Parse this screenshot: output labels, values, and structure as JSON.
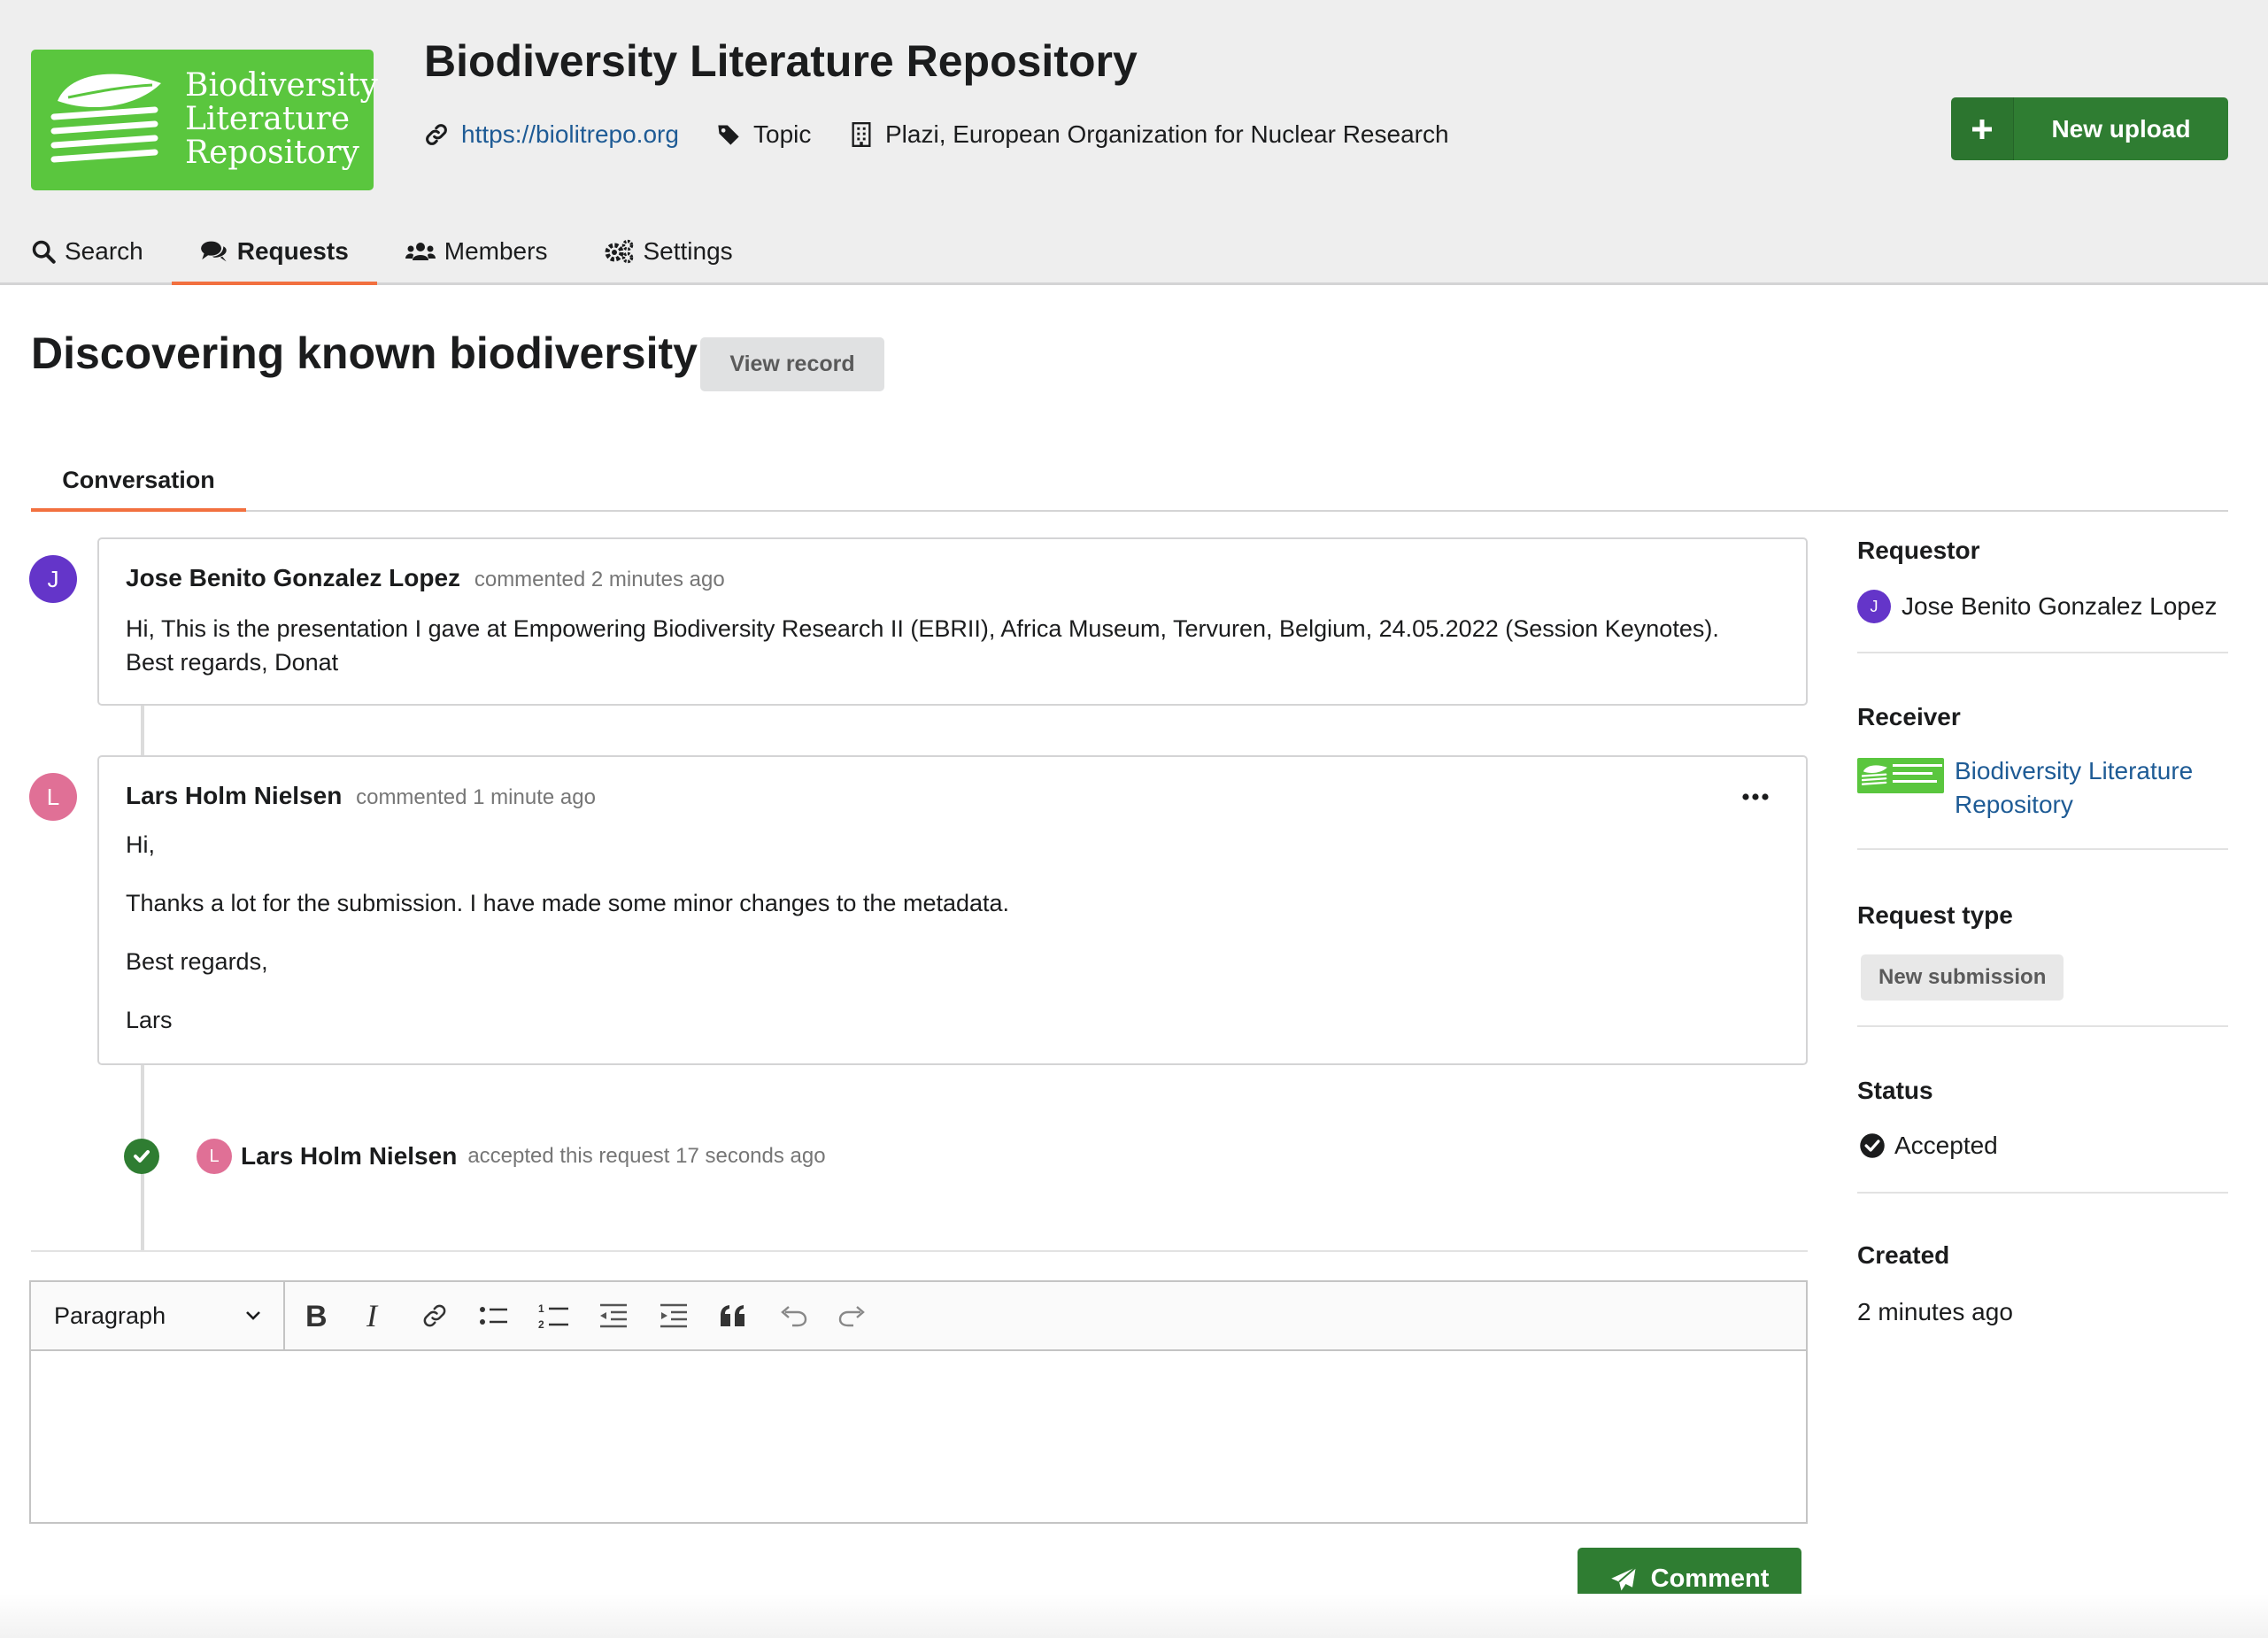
{
  "community": {
    "logo_lines": [
      "Biodiversity",
      "Literature",
      "Repository"
    ],
    "title": "Biodiversity Literature Repository",
    "website": "https://biolitrepo.org",
    "topic": "Topic",
    "organizations": "Plazi, European Organization for Nuclear Research",
    "new_upload_label": "New upload",
    "brand_color": "#5ac63e"
  },
  "menu": {
    "items": [
      {
        "label": "Search",
        "icon": "search-icon"
      },
      {
        "label": "Requests",
        "icon": "comments-icon",
        "active": true
      },
      {
        "label": "Members",
        "icon": "users-icon"
      },
      {
        "label": "Settings",
        "icon": "cogs-icon"
      }
    ],
    "active_color": "#f2703f"
  },
  "request": {
    "title": "Discovering known biodiversity",
    "view_record_label": "View record",
    "tab_label": "Conversation"
  },
  "timeline": {
    "comments": [
      {
        "avatar_letter": "J",
        "avatar_color": "#6435c9",
        "author": "Jose Benito Gonzalez Lopez",
        "when": "commented 2 minutes ago",
        "body": [
          "Hi, This is the presentation I gave at Empowering Biodiversity Research II (EBRII), Africa Museum, Tervuren, Belgium, 24.05.2022 (Session Keynotes).",
          "Best regards, Donat"
        ]
      },
      {
        "avatar_letter": "L",
        "avatar_color": "#e07096",
        "author": "Lars Holm Nielsen",
        "when": "commented 1 minute ago",
        "body": [
          "Hi,",
          "Thanks a lot for the submission. I have made some minor changes to the metadata.",
          "Best regards,",
          "Lars"
        ]
      }
    ],
    "event": {
      "avatar_letter": "L",
      "author": "Lars Holm Nielsen",
      "text": "accepted this request 17 seconds ago"
    }
  },
  "editor": {
    "block_format": "Paragraph",
    "tools": [
      "bold-icon",
      "italic-icon",
      "link-icon",
      "bulleted-list-icon",
      "numbered-list-icon",
      "outdent-icon",
      "indent-icon",
      "blockquote-icon",
      "undo-icon",
      "redo-icon"
    ],
    "comment_label": "Comment"
  },
  "sidebar": {
    "requestor_heading": "Requestor",
    "requestor_letter": "J",
    "requestor_name": "Jose Benito Gonzalez Lopez",
    "receiver_heading": "Receiver",
    "receiver_name_line1": "Biodiversity Literature",
    "receiver_name_line2": "Repository",
    "request_type_heading": "Request type",
    "request_type": "New submission",
    "status_heading": "Status",
    "status": "Accepted",
    "created_heading": "Created",
    "created": "2 minutes ago"
  },
  "colors": {
    "primary_button": "#2f7d32",
    "link": "#1e5b95"
  }
}
